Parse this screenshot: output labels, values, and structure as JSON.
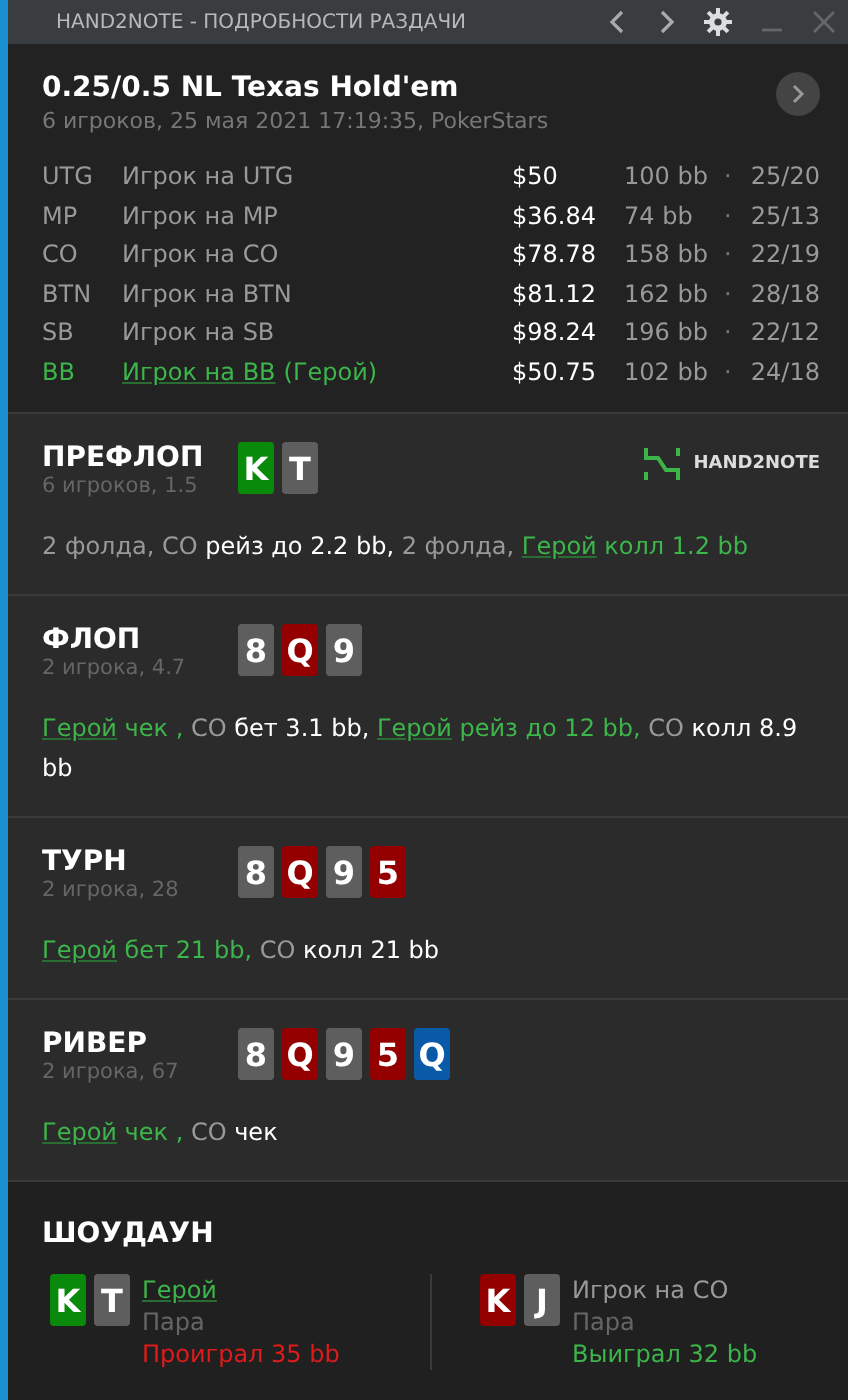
{
  "window": {
    "title": "HAND2NOTE - ПОДРОБНОСТИ РАЗДАЧИ"
  },
  "header": {
    "title": "0.25/0.5 NL Texas Hold'em",
    "subtitle": "6 игроков, 25 мая 2021 17:19:35, PokerStars"
  },
  "players": [
    {
      "position": "UTG",
      "name": "Игрок на UTG",
      "hero": false,
      "stack": "$50",
      "bb": "100 bb",
      "separator": "·",
      "stats": "25/20"
    },
    {
      "position": "MP",
      "name": "Игрок на MP",
      "hero": false,
      "stack": "$36.84",
      "bb": "74 bb",
      "separator": "·",
      "stats": "25/13"
    },
    {
      "position": "CO",
      "name": "Игрок на CO",
      "hero": false,
      "stack": "$78.78",
      "bb": "158 bb",
      "separator": "·",
      "stats": "22/19"
    },
    {
      "position": "BTN",
      "name": "Игрок на BTN",
      "hero": false,
      "stack": "$81.12",
      "bb": "162 bb",
      "separator": "·",
      "stats": "28/18"
    },
    {
      "position": "SB",
      "name": "Игрок на SB",
      "hero": false,
      "stack": "$98.24",
      "bb": "196 bb",
      "separator": "·",
      "stats": "22/12"
    },
    {
      "position": "BB",
      "name": "Игрок на BB",
      "hero": true,
      "hero_label": "(Герой)",
      "stack": "$50.75",
      "bb": "102 bb",
      "separator": "·",
      "stats": "24/18"
    }
  ],
  "streets": [
    {
      "title": "ПРЕФЛОП",
      "info": "6 игроков, 1.5",
      "logo": "HAND2NOTE",
      "cards": [
        {
          "rank": "K",
          "color": "#0a8a0a"
        },
        {
          "rank": "T",
          "color": "#5e5e5e"
        }
      ],
      "actions": [
        {
          "kind": "muted",
          "text": "2 фолда, CO "
        },
        {
          "kind": "action",
          "text": "рейз до 2.2 bb,"
        },
        {
          "kind": "muted",
          "text": " 2 фолда, "
        },
        {
          "kind": "hero",
          "text": "Герой"
        },
        {
          "kind": "hero-action",
          "text": " колл 1.2 bb"
        }
      ]
    },
    {
      "title": "ФЛОП",
      "info": "2 игрока, 4.7",
      "cards": [
        {
          "rank": "8",
          "color": "#5e5e5e"
        },
        {
          "rank": "Q",
          "color": "#940000"
        },
        {
          "rank": "9",
          "color": "#5e5e5e"
        }
      ],
      "actions": [
        {
          "kind": "hero",
          "text": "Герой"
        },
        {
          "kind": "hero-action",
          "text": " чек ,"
        },
        {
          "kind": "muted",
          "text": " CO "
        },
        {
          "kind": "action",
          "text": "бет 3.1 bb, "
        },
        {
          "kind": "hero",
          "text": "Герой"
        },
        {
          "kind": "hero-action",
          "text": " рейз до 12 bb,"
        },
        {
          "kind": "muted",
          "text": " CO "
        },
        {
          "kind": "action",
          "text": "колл 8.9 bb"
        }
      ]
    },
    {
      "title": "ТУРН",
      "info": "2 игрока, 28",
      "cards": [
        {
          "rank": "8",
          "color": "#5e5e5e"
        },
        {
          "rank": "Q",
          "color": "#940000"
        },
        {
          "rank": "9",
          "color": "#5e5e5e"
        },
        {
          "rank": "5",
          "color": "#940000"
        }
      ],
      "actions": [
        {
          "kind": "hero",
          "text": "Герой"
        },
        {
          "kind": "hero-action",
          "text": " бет 21 bb,"
        },
        {
          "kind": "muted",
          "text": " CO "
        },
        {
          "kind": "action",
          "text": "колл 21 bb"
        }
      ]
    },
    {
      "title": "РИВЕР",
      "info": "2 игрока, 67",
      "cards": [
        {
          "rank": "8",
          "color": "#5e5e5e"
        },
        {
          "rank": "Q",
          "color": "#940000"
        },
        {
          "rank": "9",
          "color": "#5e5e5e"
        },
        {
          "rank": "5",
          "color": "#940000"
        },
        {
          "rank": "Q",
          "color": "#0a5aa8"
        }
      ],
      "actions": [
        {
          "kind": "hero",
          "text": "Герой"
        },
        {
          "kind": "hero-action",
          "text": " чек ,"
        },
        {
          "kind": "muted",
          "text": " CO "
        },
        {
          "kind": "action",
          "text": "чек"
        }
      ]
    }
  ],
  "showdown": {
    "title": "ШОУДАУН",
    "hands": [
      {
        "cards": [
          {
            "rank": "K",
            "color": "#0a8a0a"
          },
          {
            "rank": "T",
            "color": "#5e5e5e"
          }
        ],
        "name": "Герой",
        "hero": true,
        "combo": "Пара",
        "result": "Проиграл 35 bb",
        "won": false
      },
      {
        "cards": [
          {
            "rank": "K",
            "color": "#940000"
          },
          {
            "rank": "J",
            "color": "#5e5e5e"
          }
        ],
        "name": "Игрок на CO",
        "hero": false,
        "combo": "Пара",
        "result": "Выиграл 32 bb",
        "won": true
      }
    ]
  }
}
